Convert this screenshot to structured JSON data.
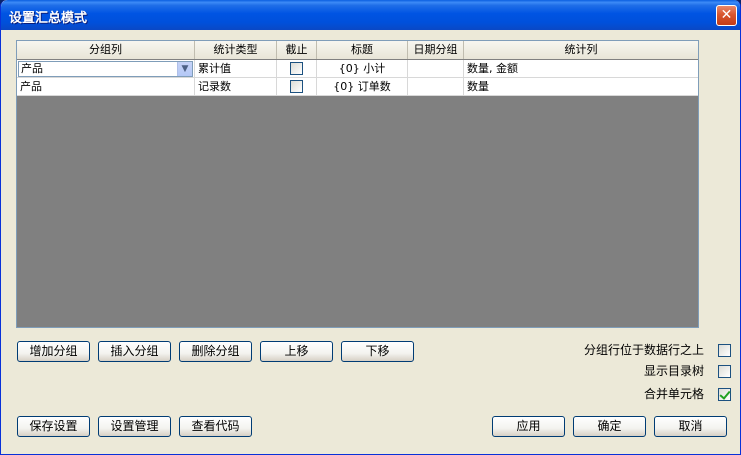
{
  "window": {
    "title": "设置汇总模式",
    "close_glyph": "✕"
  },
  "grid": {
    "headers": [
      "分组列",
      "统计类型",
      "截止",
      "标题",
      "日期分组",
      "统计列"
    ],
    "rows": [
      {
        "group_col": "产品",
        "stat_type": "累计值",
        "cutoff": false,
        "title": "{0} 小计",
        "date_group": "",
        "stat_cols": "数量, 金额"
      },
      {
        "group_col": "产品",
        "stat_type": "记录数",
        "cutoff": false,
        "title": "{0} 订单数",
        "date_group": "",
        "stat_cols": "数量"
      }
    ]
  },
  "buttons": {
    "add_group": "增加分组",
    "insert_group": "插入分组",
    "delete_group": "删除分组",
    "move_up": "上移",
    "move_down": "下移",
    "save_settings": "保存设置",
    "settings_manage": "设置管理",
    "view_code": "查看代码",
    "apply": "应用",
    "ok": "确定",
    "cancel": "取消"
  },
  "options": [
    {
      "label": "分组行位于数据行之上",
      "checked": false
    },
    {
      "label": "显示目录树",
      "checked": false
    },
    {
      "label": "合并单元格",
      "checked": true
    }
  ],
  "colors": {
    "title_bar": "#0054e3",
    "grid_empty": "#808080",
    "dialog_bg": "#ece9d8",
    "check_mark": "#21a121"
  }
}
